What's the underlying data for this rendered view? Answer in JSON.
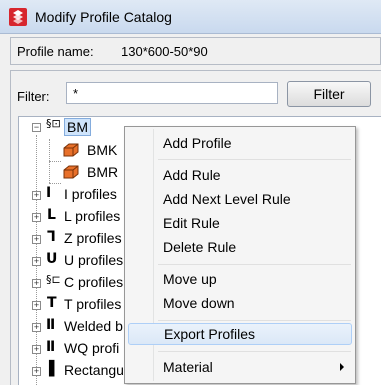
{
  "window": {
    "title": "Modify Profile Catalog"
  },
  "profile_name": {
    "label": "Profile name:",
    "value": "130*600-50*90"
  },
  "filter": {
    "label": "Filter:",
    "value": "*",
    "button": "Filter"
  },
  "tree": {
    "root": {
      "label": "BM",
      "expander": "−"
    },
    "children": [
      {
        "label": "BMK"
      },
      {
        "label": "BMR"
      }
    ],
    "groups": [
      {
        "label": "I profiles",
        "icon_glyph": "⊥"
      },
      {
        "label": "L profiles",
        "icon_glyph": "L"
      },
      {
        "label": "Z profiles",
        "icon_glyph": "Z"
      },
      {
        "label": "U profiles",
        "icon_glyph": "U"
      },
      {
        "label": "C profiles",
        "icon_glyph": "C"
      },
      {
        "label": "T profiles",
        "icon_glyph": "T"
      },
      {
        "label": "Welded b",
        "icon_glyph": "Ш"
      },
      {
        "label": "WQ profi",
        "icon_glyph": "Ш"
      },
      {
        "label": "Rectangu",
        "icon_glyph": "|"
      }
    ]
  },
  "context_menu": {
    "items": [
      {
        "label": "Add Profile"
      },
      {
        "label": "Add Rule"
      },
      {
        "label": "Add Next Level Rule"
      },
      {
        "label": "Edit Rule"
      },
      {
        "label": "Delete Rule"
      },
      {
        "label": "Move up"
      },
      {
        "label": "Move down"
      },
      {
        "label": "Export Profiles"
      },
      {
        "label": "Material"
      }
    ]
  },
  "colors": {
    "selection": "#cfe4fb",
    "profile_icon": "#e8702a",
    "app_icon": "#d7262e"
  }
}
